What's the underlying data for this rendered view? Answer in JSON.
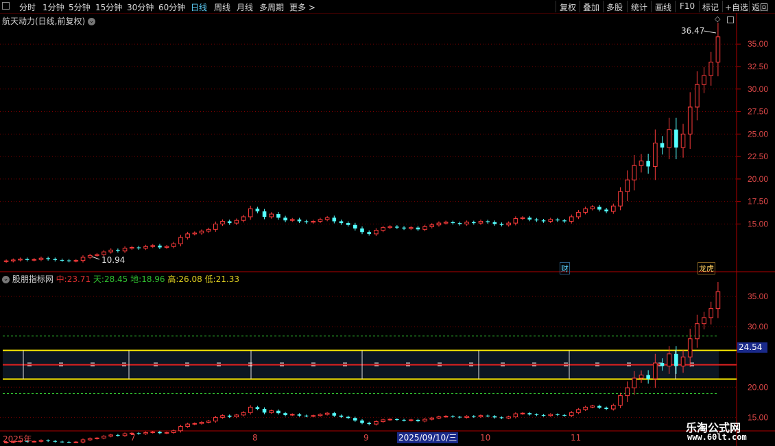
{
  "toolbar": {
    "periods": [
      "分时",
      "1分钟",
      "5分钟",
      "15分钟",
      "30分钟",
      "60分钟",
      "日线",
      "周线",
      "月线",
      "多周期",
      "更多 >"
    ],
    "active_period": "日线",
    "tools": [
      "复权",
      "叠加",
      "多股",
      "统计",
      "画线",
      "F10",
      "+自选",
      "返回"
    ],
    "mark_label": "标记"
  },
  "main_panel": {
    "title": "航天动力(日线,前复权)",
    "high_label": "36.47",
    "low_label": "10.94",
    "event_tags": [
      "财",
      "龙虎"
    ],
    "yticks": [
      "35.00",
      "32.50",
      "30.00",
      "27.50",
      "25.00",
      "22.50",
      "20.00",
      "17.50",
      "15.00"
    ]
  },
  "indicator_panel": {
    "name": "股朋指标网",
    "values": [
      {
        "label": "中:",
        "value": "23.71",
        "color": "#e03030"
      },
      {
        "label": "天:",
        "value": "28.45",
        "color": "#30c030"
      },
      {
        "label": "地:",
        "value": "18.96",
        "color": "#30c030"
      },
      {
        "label": "高:",
        "value": "26.08",
        "color": "#e0d020"
      },
      {
        "label": "低:",
        "value": "21.33",
        "color": "#e0d020"
      }
    ],
    "yticks": [
      "35.00",
      "30.00",
      "20.00",
      "15.00"
    ],
    "current_price_box": "24.54"
  },
  "xaxis": {
    "labels": [
      "2025年",
      "7",
      "8",
      "9",
      "10",
      "11"
    ],
    "cursor_date": "2025/09/10/三"
  },
  "watermark": {
    "line1": "乐淘公式网",
    "line2": "www.60lt.com"
  },
  "colors": {
    "up": "#ff3c3c",
    "down": "#54ffff",
    "background": "#000000",
    "grid": "#7a0000",
    "band": "#0c1622",
    "band_high": "#ffee00",
    "band_mid": "#e02020"
  },
  "chart_data": {
    "type": "candlestick",
    "high": 36.47,
    "low": 10.94,
    "closes": [
      10.9,
      11.0,
      11.1,
      11.0,
      11.05,
      11.2,
      11.1,
      11.0,
      10.95,
      10.9,
      10.94,
      11.3,
      11.5,
      11.6,
      11.9,
      12.1,
      12.0,
      12.3,
      12.4,
      12.3,
      12.5,
      12.6,
      12.4,
      12.5,
      12.8,
      13.5,
      13.9,
      14.0,
      14.2,
      14.4,
      15.0,
      15.3,
      15.1,
      15.4,
      15.8,
      16.7,
      16.4,
      15.8,
      16.1,
      15.7,
      15.4,
      15.5,
      15.3,
      15.2,
      15.3,
      15.5,
      15.7,
      15.3,
      15.1,
      14.9,
      14.5,
      14.1,
      13.9,
      14.3,
      14.6,
      14.7,
      14.6,
      14.5,
      14.6,
      14.4,
      14.7,
      14.9,
      15.1,
      15.2,
      15.1,
      15.0,
      15.2,
      15.1,
      15.3,
      15.2,
      15.0,
      14.9,
      15.1,
      15.6,
      15.7,
      15.5,
      15.4,
      15.3,
      15.5,
      15.4,
      15.3,
      15.8,
      16.3,
      16.7,
      16.9,
      16.6,
      16.4,
      17.0,
      18.6,
      19.9,
      21.5,
      22.0,
      21.4,
      24.0,
      23.5,
      25.5,
      23.5,
      25.0,
      28.0,
      30.5,
      31.5,
      33.0,
      35.8
    ],
    "indicator": {
      "mid": 23.71,
      "sky": 28.45,
      "ground": 18.96,
      "high": 26.08,
      "low": 21.33
    }
  }
}
